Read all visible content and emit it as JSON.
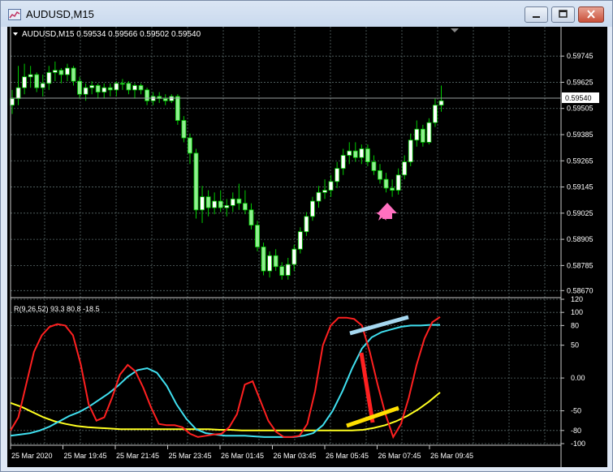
{
  "window": {
    "title": "AUDUSD,M15"
  },
  "info_label": "AUDUSD,M15  0.59534 0.59566 0.59502 0.59540",
  "price_axis": [
    "0.59745",
    "0.59625",
    "0.59505",
    "0.59385",
    "0.59265",
    "0.59145",
    "0.59025",
    "0.58905",
    "0.58785",
    "0.58670"
  ],
  "current_price": "0.59540",
  "indicator_label": "R(9,26,52) 93.3 80.8 -18.5",
  "indicator_axis": [
    "120",
    "100",
    "80",
    "50",
    "0.00",
    "-50",
    "-80",
    "-100"
  ],
  "time_axis": [
    "25 Mar 2020",
    "25 Mar 19:45",
    "25 Mar 21:45",
    "25 Mar 23:45",
    "26 Mar 01:45",
    "26 Mar 03:45",
    "26 Mar 05:45",
    "26 Mar 07:45",
    "26 Mar 09:45"
  ],
  "colors": {
    "bull": "#ffffff",
    "bear": "#90ee90",
    "candle_outline": "#00cc00",
    "grid": "#5a6a6a",
    "red": "#ff2020",
    "cyan": "#40e0f0",
    "yellow": "#ffff20",
    "arrow": "#ff70c0"
  },
  "chart_data": {
    "type": "candlestick",
    "price_ylim": [
      0.5866,
      0.5982
    ],
    "indicator_ylim": [
      -100,
      120
    ],
    "candles": [
      [
        0.5952,
        0.5959,
        0.5948,
        0.5955
      ],
      [
        0.5955,
        0.597,
        0.5952,
        0.596
      ],
      [
        0.596,
        0.5971,
        0.5957,
        0.5965
      ],
      [
        0.5965,
        0.597,
        0.596,
        0.5966
      ],
      [
        0.5966,
        0.5967,
        0.5958,
        0.596
      ],
      [
        0.596,
        0.5966,
        0.5956,
        0.5962
      ],
      [
        0.5962,
        0.597,
        0.5959,
        0.5967
      ],
      [
        0.5967,
        0.5972,
        0.5963,
        0.5968
      ],
      [
        0.5968,
        0.5969,
        0.5962,
        0.5966
      ],
      [
        0.5966,
        0.5971,
        0.5963,
        0.5969
      ],
      [
        0.5969,
        0.597,
        0.5961,
        0.5963
      ],
      [
        0.5963,
        0.5965,
        0.5955,
        0.5957
      ],
      [
        0.5957,
        0.5962,
        0.5954,
        0.596
      ],
      [
        0.596,
        0.5963,
        0.5957,
        0.5961
      ],
      [
        0.5961,
        0.5962,
        0.5955,
        0.5958
      ],
      [
        0.5958,
        0.5962,
        0.5955,
        0.596
      ],
      [
        0.596,
        0.5962,
        0.5956,
        0.5959
      ],
      [
        0.5959,
        0.5963,
        0.5956,
        0.5962
      ],
      [
        0.5962,
        0.5964,
        0.5959,
        0.5962
      ],
      [
        0.5962,
        0.5963,
        0.5957,
        0.5959
      ],
      [
        0.5959,
        0.5962,
        0.5955,
        0.5961
      ],
      [
        0.5961,
        0.5962,
        0.5957,
        0.5959
      ],
      [
        0.5959,
        0.596,
        0.5952,
        0.5954
      ],
      [
        0.5954,
        0.5958,
        0.5952,
        0.5956
      ],
      [
        0.5956,
        0.5958,
        0.5953,
        0.5955
      ],
      [
        0.5955,
        0.5957,
        0.5952,
        0.5954
      ],
      [
        0.5954,
        0.5957,
        0.5953,
        0.5956
      ],
      [
        0.5956,
        0.5957,
        0.5943,
        0.5945
      ],
      [
        0.5945,
        0.5947,
        0.5935,
        0.5937
      ],
      [
        0.5937,
        0.5939,
        0.5925,
        0.593
      ],
      [
        0.593,
        0.5932,
        0.59,
        0.5904
      ],
      [
        0.5904,
        0.5915,
        0.5898,
        0.591
      ],
      [
        0.591,
        0.5913,
        0.5901,
        0.5905
      ],
      [
        0.5905,
        0.5912,
        0.5902,
        0.5908
      ],
      [
        0.5908,
        0.5913,
        0.5903,
        0.5905
      ],
      [
        0.5905,
        0.5909,
        0.5901,
        0.5906
      ],
      [
        0.5906,
        0.5912,
        0.5903,
        0.5909
      ],
      [
        0.5909,
        0.5916,
        0.5904,
        0.5907
      ],
      [
        0.5907,
        0.5913,
        0.5902,
        0.5904
      ],
      [
        0.5904,
        0.5907,
        0.5895,
        0.5897
      ],
      [
        0.5897,
        0.5899,
        0.5885,
        0.5887
      ],
      [
        0.5887,
        0.5889,
        0.5874,
        0.5876
      ],
      [
        0.5876,
        0.5885,
        0.5873,
        0.5883
      ],
      [
        0.5883,
        0.5886,
        0.5876,
        0.5878
      ],
      [
        0.5878,
        0.588,
        0.5872,
        0.5874
      ],
      [
        0.5874,
        0.5882,
        0.5872,
        0.5879
      ],
      [
        0.5879,
        0.5888,
        0.5876,
        0.5886
      ],
      [
        0.5886,
        0.5896,
        0.5884,
        0.5894
      ],
      [
        0.5894,
        0.5903,
        0.5892,
        0.5901
      ],
      [
        0.5901,
        0.591,
        0.5899,
        0.5908
      ],
      [
        0.5908,
        0.5915,
        0.5905,
        0.5912
      ],
      [
        0.5912,
        0.5918,
        0.5909,
        0.5913
      ],
      [
        0.5913,
        0.592,
        0.591,
        0.5917
      ],
      [
        0.5917,
        0.5926,
        0.5914,
        0.5923
      ],
      [
        0.5923,
        0.5932,
        0.592,
        0.5929
      ],
      [
        0.5929,
        0.5935,
        0.5925,
        0.5931
      ],
      [
        0.5931,
        0.5935,
        0.5926,
        0.5928
      ],
      [
        0.5928,
        0.5934,
        0.5925,
        0.5932
      ],
      [
        0.5932,
        0.5934,
        0.5924,
        0.5926
      ],
      [
        0.5926,
        0.5929,
        0.592,
        0.5922
      ],
      [
        0.5922,
        0.5925,
        0.5916,
        0.5918
      ],
      [
        0.5918,
        0.5921,
        0.5912,
        0.5914
      ],
      [
        0.5914,
        0.5918,
        0.591,
        0.5913
      ],
      [
        0.5913,
        0.5923,
        0.5911,
        0.592
      ],
      [
        0.592,
        0.5929,
        0.5918,
        0.5926
      ],
      [
        0.5926,
        0.5939,
        0.5924,
        0.5936
      ],
      [
        0.5936,
        0.5945,
        0.5933,
        0.5941
      ],
      [
        0.5941,
        0.5943,
        0.5933,
        0.5935
      ],
      [
        0.5935,
        0.5946,
        0.5934,
        0.5944
      ],
      [
        0.5944,
        0.5955,
        0.5942,
        0.5952
      ],
      [
        0.5952,
        0.5961,
        0.5949,
        0.5954
      ]
    ],
    "red_line": [
      -80,
      -60,
      -10,
      40,
      65,
      78,
      82,
      80,
      65,
      20,
      -40,
      -65,
      -60,
      -30,
      5,
      20,
      10,
      -15,
      -45,
      -70,
      -72,
      -72,
      -75,
      -85,
      -90,
      -88,
      -86,
      -85,
      -75,
      -55,
      -10,
      -5,
      -35,
      -65,
      -82,
      -90,
      -90,
      -88,
      -70,
      -20,
      50,
      80,
      92,
      92,
      90,
      80,
      40,
      -10,
      -55,
      -90,
      -70,
      -30,
      20,
      60,
      85,
      93
    ],
    "cyan_line": [
      -88,
      -86,
      -84,
      -80,
      -74,
      -66,
      -58,
      -52,
      -44,
      -34,
      -24,
      -12,
      2,
      12,
      15,
      8,
      -12,
      -40,
      -62,
      -78,
      -84,
      -86,
      -88,
      -88,
      -88,
      -89,
      -90,
      -90,
      -90,
      -90,
      -88,
      -84,
      -72,
      -50,
      -20,
      15,
      45,
      62,
      70,
      74,
      78,
      80,
      80,
      81,
      81
    ],
    "yellow_line": [
      -38,
      -44,
      -52,
      -60,
      -66,
      -70,
      -73,
      -75,
      -76,
      -77,
      -78,
      -78,
      -78,
      -78,
      -78,
      -78,
      -78,
      -78,
      -78,
      -79,
      -79,
      -80,
      -80,
      -80,
      -80,
      -80,
      -80,
      -80,
      -80,
      -80,
      -80,
      -80,
      -79,
      -76,
      -72,
      -66,
      -58,
      -48,
      -36,
      -22
    ]
  }
}
